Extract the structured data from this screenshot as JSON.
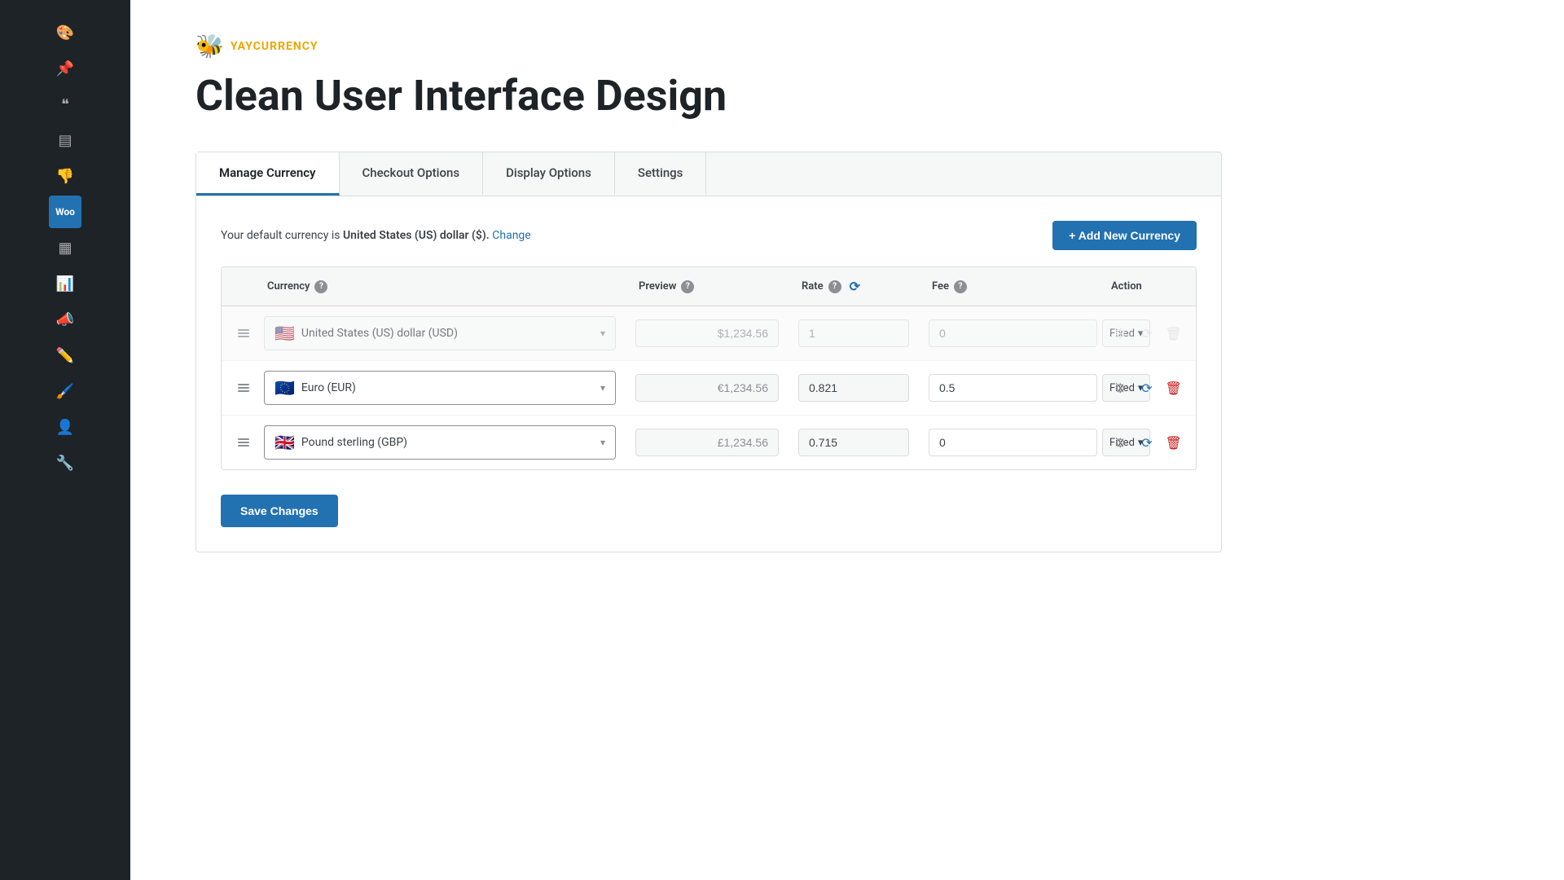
{
  "brand": {
    "logo": "🐝",
    "name": "YAYCURRENCY"
  },
  "page_title": "Clean User Interface Design",
  "tabs": [
    {
      "id": "manage",
      "label": "Manage Currency",
      "active": true
    },
    {
      "id": "checkout",
      "label": "Checkout Options",
      "active": false
    },
    {
      "id": "display",
      "label": "Display Options",
      "active": false
    },
    {
      "id": "settings",
      "label": "Settings",
      "active": false
    }
  ],
  "default_currency_notice": "Your default currency is",
  "default_currency_name": "United States (US) dollar ($).",
  "change_link": "Change",
  "add_currency_btn": "+ Add New Currency",
  "table_headers": {
    "currency": "Currency",
    "preview": "Preview",
    "rate": "Rate",
    "fee": "Fee",
    "action": "Action"
  },
  "currencies": [
    {
      "id": "usd",
      "flag": "🇺🇸",
      "name": "United States (US) dollar (USD)",
      "preview": "$1,234.56",
      "rate": "1",
      "fee": "0",
      "fee_type": "Fixed",
      "is_default": true
    },
    {
      "id": "eur",
      "flag": "🇪🇺",
      "name": "Euro (EUR)",
      "preview": "€1,234.56",
      "rate": "0.821",
      "fee": "0.5",
      "fee_type": "Fixed",
      "is_default": false
    },
    {
      "id": "gbp",
      "flag": "🇬🇧",
      "name": "Pound sterling (GBP)",
      "preview": "£1,234.56",
      "rate": "0.715",
      "fee": "0",
      "fee_type": "Fixed",
      "is_default": false
    }
  ],
  "save_button": "Save Changes",
  "sidebar_icons": [
    {
      "id": "paint",
      "symbol": "🎨"
    },
    {
      "id": "push-pin",
      "symbol": "📌"
    },
    {
      "id": "quote",
      "symbol": "❝"
    },
    {
      "id": "layers",
      "symbol": "▤"
    },
    {
      "id": "thumb-down",
      "symbol": "👎"
    },
    {
      "id": "woo",
      "label": "Woo"
    },
    {
      "id": "table",
      "symbol": "▦"
    },
    {
      "id": "chart",
      "symbol": "📊"
    },
    {
      "id": "megaphone",
      "symbol": "📣"
    },
    {
      "id": "pen",
      "symbol": "✏️"
    },
    {
      "id": "paint-brush",
      "symbol": "🖌️"
    },
    {
      "id": "person",
      "symbol": "👤"
    },
    {
      "id": "wrench",
      "symbol": "🔧"
    }
  ]
}
